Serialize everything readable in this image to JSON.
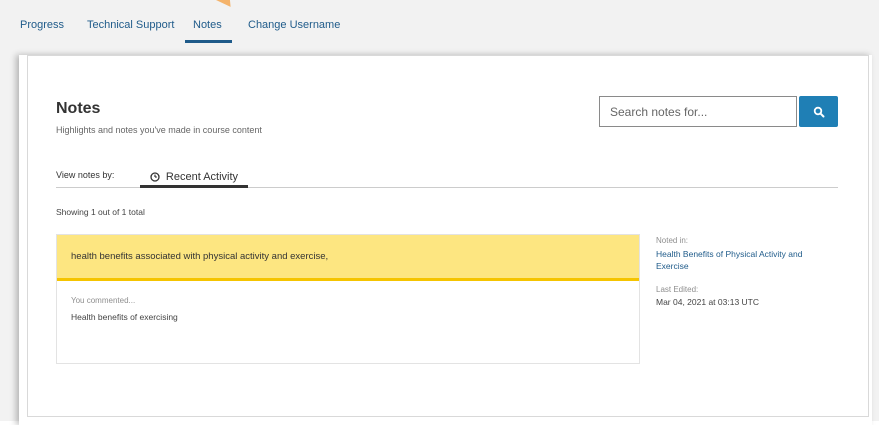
{
  "nav": {
    "items": [
      {
        "label": "Progress"
      },
      {
        "label": "Technical Support"
      },
      {
        "label": "Notes"
      },
      {
        "label": "Change Username"
      }
    ]
  },
  "header": {
    "title": "Notes",
    "subtitle": "Highlights and notes you've made in course content"
  },
  "search": {
    "placeholder": "Search notes for..."
  },
  "view": {
    "label": "View notes by:",
    "tab_label": "Recent Activity"
  },
  "summary": "Showing 1 out of 1 total",
  "note": {
    "highlight": "health benefits associated with physical activity and exercise,",
    "comment_label": "You commented...",
    "comment": "Health benefits of exercising",
    "noted_in_label": "Noted in:",
    "noted_in_link": "Health Benefits of Physical Activity and Exercise",
    "last_edited_label": "Last Edited:",
    "last_edited_value": "Mar 04, 2021 at 03:13 UTC"
  },
  "colors": {
    "accent": "#1f7fb5",
    "link": "#1f5b8a",
    "highlight": "#fde681"
  }
}
